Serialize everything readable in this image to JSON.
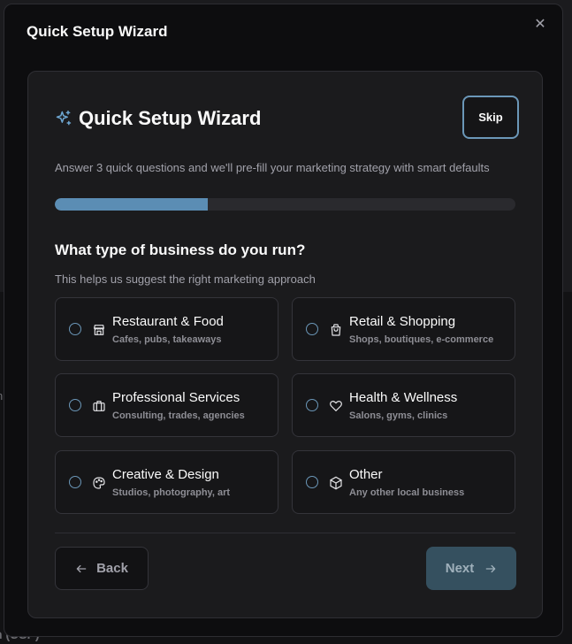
{
  "dialog": {
    "title": "Quick Setup Wizard"
  },
  "wizard": {
    "title": "Quick Setup Wizard",
    "skip_label": "Skip",
    "intro": "Answer 3 quick questions and we'll pre-fill your marketing strategy with smart defaults",
    "progress_fraction": 0.333,
    "question": "What type of business do you run?",
    "question_help": "This helps us suggest the right marketing approach",
    "options": [
      {
        "label": "Restaurant & Food",
        "description": "Cafes, pubs, takeaways",
        "icon": "store-icon",
        "selected": false
      },
      {
        "label": "Retail & Shopping",
        "description": "Shops, boutiques, e-commerce",
        "icon": "shopping-bag-icon",
        "selected": false
      },
      {
        "label": "Professional Services",
        "description": "Consulting, trades, agencies",
        "icon": "briefcase-icon",
        "selected": false
      },
      {
        "label": "Health & Wellness",
        "description": "Salons, gyms, clinics",
        "icon": "heart-icon",
        "selected": false
      },
      {
        "label": "Creative & Design",
        "description": "Studios, photography, art",
        "icon": "palette-icon",
        "selected": false
      },
      {
        "label": "Other",
        "description": "Any other local business",
        "icon": "box-icon",
        "selected": false
      }
    ],
    "back_label": "Back",
    "next_label": "Next"
  },
  "colors": {
    "accent": "#5b8db4",
    "radio_border": "#6b97b8",
    "next_disabled_bg": "#35505f"
  }
}
